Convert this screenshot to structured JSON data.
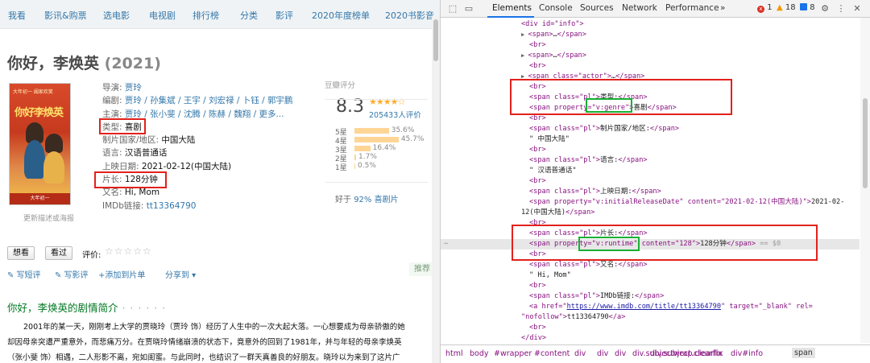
{
  "nav": [
    "我看",
    "影讯&购票",
    "选电影",
    "电视剧",
    "排行榜",
    "分类",
    "影评",
    "2020年度榜单",
    "2020书影音"
  ],
  "movie": {
    "title": "你好，李焕英",
    "year": "(2021)",
    "poster_caption": "更新描述或海报",
    "poster_text": "你好李焕英",
    "poster_top": "大年初一 阖家欢笑",
    "poster_foot": "大年初一",
    "info": [
      {
        "label": "导演:",
        "value": "贾玲"
      },
      {
        "label": "编剧:",
        "value": "贾玲 / 孙集斌 / 王宇 / 刘宏禄 / 卜钰 / 郭宇鹏"
      },
      {
        "label": "主演:",
        "value": "贾玲 / 张小斐 / 沈腾 / 陈赫 / 魏翔 / 更多..."
      },
      {
        "label": "类型:",
        "value": "喜剧"
      },
      {
        "label": "制片国家/地区:",
        "value": "中国大陆"
      },
      {
        "label": "语言:",
        "value": "汉语普通话"
      },
      {
        "label": "上映日期:",
        "value": "2021-02-12(中国大陆)"
      },
      {
        "label": "片长:",
        "value": "128分钟"
      },
      {
        "label": "又名:",
        "value": "Hi, Mom"
      },
      {
        "label": "IMDb链接:",
        "value": "tt13364790"
      }
    ],
    "rating_label": "豆瓣评分",
    "score": "8.3",
    "stars": "★★★★☆",
    "votes": "205433人评价",
    "distribution": [
      {
        "label": "5星",
        "pct": "35.6%",
        "value": 35.6
      },
      {
        "label": "4星",
        "pct": "45.7%",
        "value": 45.7
      },
      {
        "label": "3星",
        "pct": "16.4%",
        "value": 16.4
      },
      {
        "label": "2星",
        "pct": "1.7%",
        "value": 1.7
      },
      {
        "label": "1星",
        "pct": "0.5%",
        "value": 0.5
      }
    ],
    "better_prefix": "好于",
    "better_link": "92% 喜剧片",
    "want_button": "想看",
    "seen_button": "看过",
    "rate_label": "评价:",
    "rate_stars": "☆☆☆☆☆",
    "actions": [
      "✎ 写短评",
      "✎ 写影评",
      "+添加到片单",
      "分享到 ▾"
    ],
    "recommend": "推荐",
    "synopsis_heading": "你好，李焕英的剧情简介",
    "synopsis_dots": " · · · · · ·",
    "synopsis": [
      "2001年的某一天，刚刚考上大学的贾晓玲（贾玲 饰）经历了人生中的一次大起大落。一心想要成为母亲骄傲的她",
      "却因母亲突遭严重意外，而悲痛万分。在贾晓玲情绪崩溃的状态下，竟意外的回到了1981年，并与年轻的母亲李焕英",
      "（张小斐 饰）相遇，二人形影不离，宛如闺蜜。与此同时，也结识了一群天真善良的好朋友。晓玲以为来到了这片广"
    ]
  },
  "devtools": {
    "tabs": [
      "Elements",
      "Console",
      "Sources",
      "Network",
      "Performance"
    ],
    "more": "»",
    "errors": "1",
    "warnings": "18",
    "info": "8",
    "lines": [
      {
        "pre": "",
        "tag": "<div id=\"info\">",
        "text": ""
      },
      {
        "pre": "▶ ",
        "tag": "<span>",
        "text": "…",
        "close": "</span>"
      },
      {
        "pre": "",
        "tag": "<br>",
        "text": ""
      },
      {
        "pre": "▶ ",
        "tag": "<span>",
        "text": "…",
        "close": "</span>"
      },
      {
        "pre": "",
        "tag": "<br>",
        "text": ""
      },
      {
        "pre": "▶ ",
        "tag": "<span class=\"actor\">",
        "text": "…",
        "close": "</span>"
      },
      {
        "pre": "",
        "tag": "<br>",
        "text": ""
      },
      {
        "pre": "",
        "tag": "<span class=\"pl\">",
        "text": "类型:",
        "close": "</span>"
      },
      {
        "pre": "",
        "tag": "<span property=\"v:genre\">",
        "text": "喜剧",
        "close": "</span>"
      },
      {
        "pre": "",
        "tag": "<br>",
        "text": ""
      },
      {
        "pre": "",
        "tag": "<span class=\"pl\">",
        "text": "制片国家/地区:",
        "close": "</span>"
      },
      {
        "pre": "",
        "tag": "",
        "text": "\" 中国大陆\""
      },
      {
        "pre": "",
        "tag": "<br>",
        "text": ""
      },
      {
        "pre": "",
        "tag": "<span class=\"pl\">",
        "text": "语言:",
        "close": "</span>"
      },
      {
        "pre": "",
        "tag": "",
        "text": "\" 汉语普通话\""
      },
      {
        "pre": "",
        "tag": "<br>",
        "text": ""
      },
      {
        "pre": "",
        "tag": "<span class=\"pl\">",
        "text": "上映日期:",
        "close": "</span>"
      },
      {
        "pre": "",
        "tag": "<span property=\"v:initialReleaseDate\" content=\"2021-02-12(中国大陆)\">",
        "text": "2021-02-",
        "close": ""
      },
      {
        "pre": "",
        "tag": "",
        "text": "12(中国大陆)",
        "close": "</span>"
      },
      {
        "pre": "",
        "tag": "<br>",
        "text": ""
      },
      {
        "pre": "",
        "tag": "<span class=\"pl\">",
        "text": "片长:",
        "close": "</span>"
      },
      {
        "pre": "",
        "tag": "<span property=\"v:runtime\" content=\"128\">",
        "text": "128分钟",
        "close": "</span>",
        "extra": " == $0"
      },
      {
        "pre": "",
        "tag": "<br>",
        "text": ""
      },
      {
        "pre": "",
        "tag": "<span class=\"pl\">",
        "text": "又名:",
        "close": "</span>"
      },
      {
        "pre": "",
        "tag": "",
        "text": "\" Hi, Mom\""
      },
      {
        "pre": "",
        "tag": "<br>",
        "text": ""
      },
      {
        "pre": "",
        "tag": "<span class=\"pl\">",
        "text": "IMDb链接:",
        "close": "</span>"
      },
      {
        "pre": "",
        "tag": "<a href=\"",
        "link": "https://www.imdb.com/title/tt13364790",
        "tag2": "\" target=\"_blank\" rel=",
        "text": ""
      },
      {
        "pre": "",
        "tag": "\"nofollow\">",
        "text": "tt13364790",
        "close": "</a>"
      },
      {
        "pre": "",
        "tag": "<br>",
        "text": ""
      },
      {
        "pre": "",
        "tag": "</div>",
        "text": ""
      }
    ],
    "breadcrumbs": [
      "html",
      "body",
      "#wrapper",
      "#content",
      "div",
      "div",
      "div",
      "div.subjectwrap.clearfix",
      "div.subject.clearfix",
      "div#info",
      "span"
    ]
  }
}
